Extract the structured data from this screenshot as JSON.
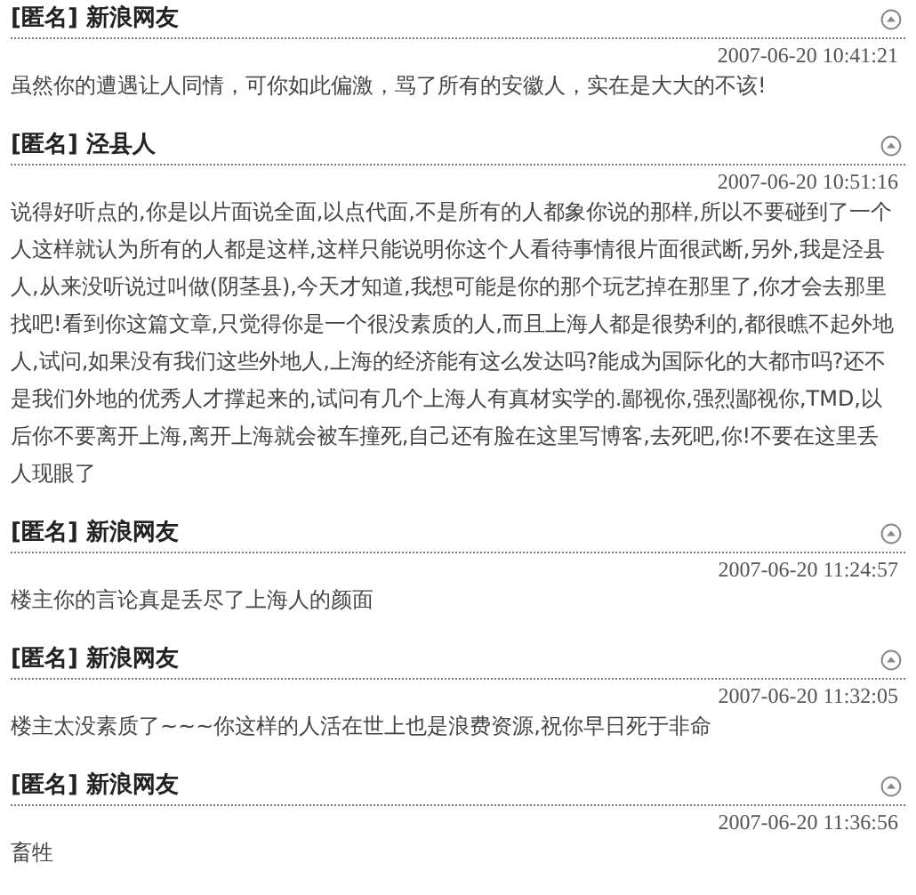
{
  "comments": [
    {
      "author": "[匿名] 新浪网友",
      "time": "2007-06-20 10:41:21",
      "text": "虽然你的遭遇让人同情，可你如此偏激，骂了所有的安徽人，实在是大大的不该!"
    },
    {
      "author": "[匿名] 泾县人",
      "time": "2007-06-20 10:51:16",
      "text": "说得好听点的,你是以片面说全面,以点代面,不是所有的人都象你说的那样,所以不要碰到了一个人这样就认为所有的人都是这样,这样只能说明你这个人看待事情很片面很武断,另外,我是泾县人,从来没听说过叫做(阴茎县),今天才知道,我想可能是你的那个玩艺掉在那里了,你才会去那里找吧!看到你这篇文章,只觉得你是一个很没素质的人,而且上海人都是很势利的,都很瞧不起外地人,试问,如果没有我们这些外地人,上海的经济能有这么发达吗?能成为国际化的大都市吗?还不是我们外地的优秀人才撑起来的,试问有几个上海人有真材实学的.鄙视你,强烈鄙视你,TMD,以后你不要离开上海,离开上海就会被车撞死,自己还有脸在这里写博客,去死吧,你!不要在这里丢人现眼了"
    },
    {
      "author": "[匿名] 新浪网友",
      "time": "2007-06-20 11:24:57",
      "text": "楼主你的言论真是丢尽了上海人的颜面"
    },
    {
      "author": "[匿名] 新浪网友",
      "time": "2007-06-20 11:32:05",
      "text": "楼主太没素质了~~~你这样的人活在世上也是浪费资源,祝你早日死于非命"
    },
    {
      "author": "[匿名] 新浪网友",
      "time": "2007-06-20 11:36:56",
      "text": "畜牲"
    }
  ]
}
